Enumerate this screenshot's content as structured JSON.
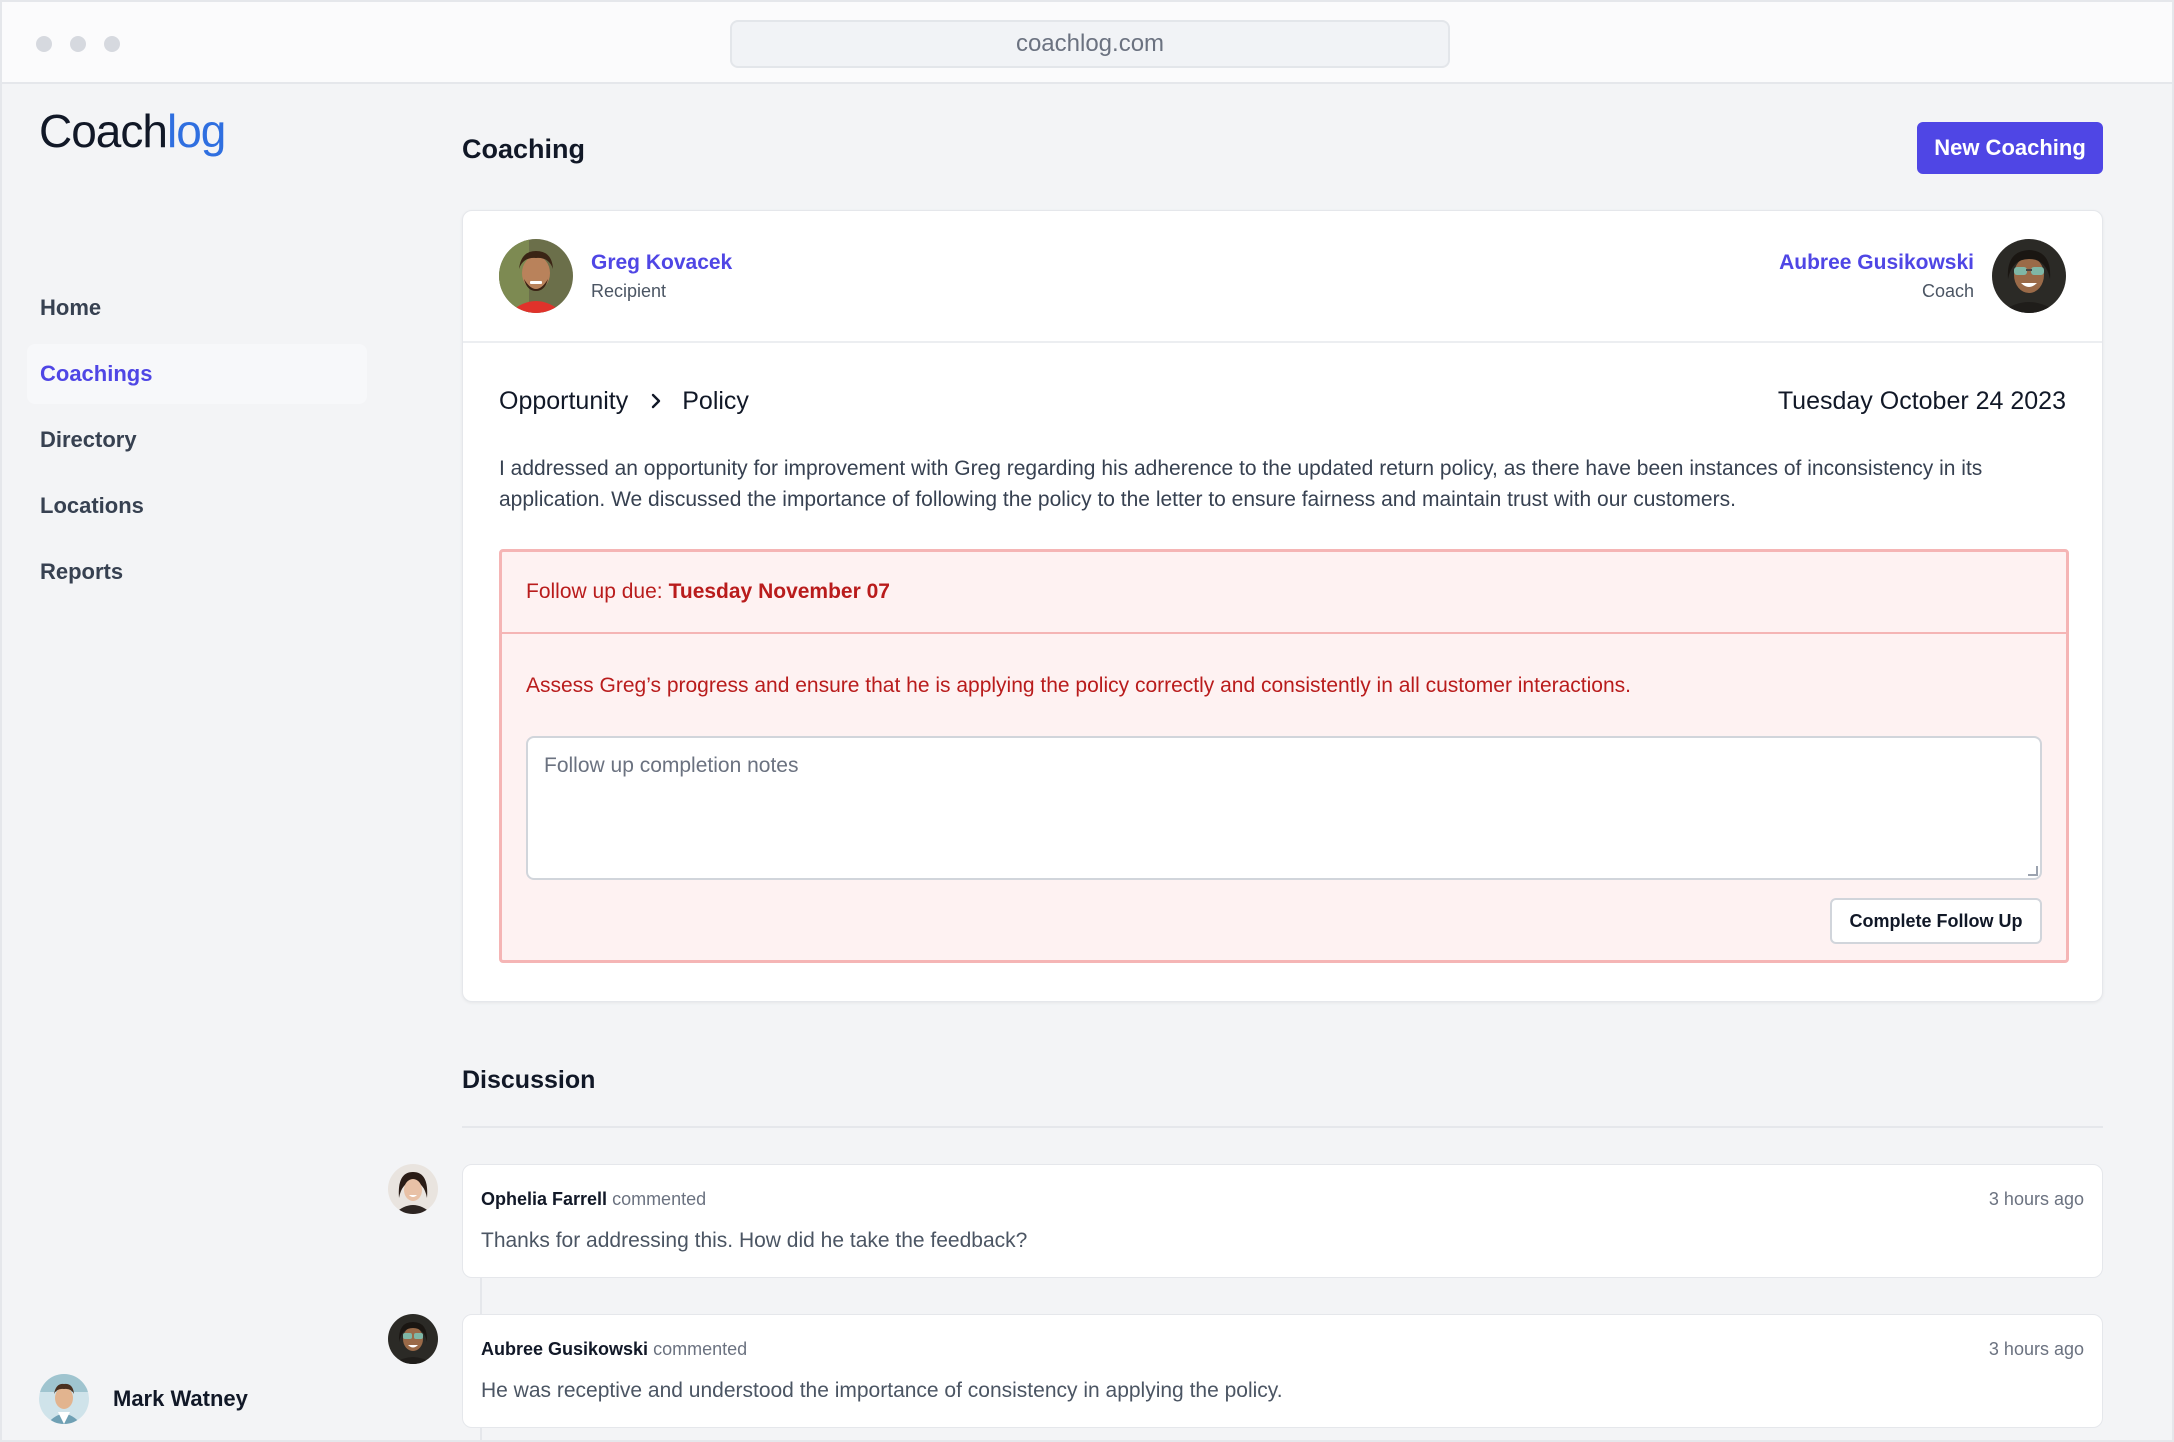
{
  "browser": {
    "url": "coachlog.com"
  },
  "brand": {
    "name_part1": "Coach",
    "name_part2": "log",
    "accent": "#2f6fe0"
  },
  "sidebar": {
    "items": [
      {
        "label": "Home",
        "active": false
      },
      {
        "label": "Coachings",
        "active": true
      },
      {
        "label": "Directory",
        "active": false
      },
      {
        "label": "Locations",
        "active": false
      },
      {
        "label": "Reports",
        "active": false
      }
    ],
    "user": {
      "name": "Mark Watney"
    }
  },
  "header": {
    "title": "Coaching",
    "new_button": "New Coaching",
    "accent": "#4f46e5"
  },
  "coaching": {
    "recipient": {
      "name": "Greg Kovacek",
      "role": "Recipient"
    },
    "coach": {
      "name": "Aubree Gusikowski",
      "role": "Coach"
    },
    "category": "Opportunity",
    "subcategory": "Policy",
    "date": "Tuesday October 24 2023",
    "description": "I addressed an opportunity for improvement with Greg regarding his adherence to the updated return policy, as there have been instances of inconsistency in its application. We discussed the importance of following the policy to the letter to ensure fairness and maintain trust with our customers.",
    "followup": {
      "due_label": "Follow up due:",
      "due_date": "Tuesday November 07",
      "task": "Assess Greg’s progress and ensure that he is applying the policy correctly and consistently in all customer interactions.",
      "notes_placeholder": "Follow up completion notes",
      "notes_value": "",
      "complete_button": "Complete Follow Up",
      "alert_color": "#b91c1c"
    }
  },
  "discussion": {
    "title": "Discussion",
    "comments": [
      {
        "author": "Ophelia Farrell",
        "action": "commented",
        "time": "3 hours ago",
        "text": "Thanks for addressing this. How did he take the feedback?"
      },
      {
        "author": "Aubree Gusikowski",
        "action": "commented",
        "time": "3 hours ago",
        "text": "He was receptive and understood the importance of consistency in applying the policy."
      }
    ]
  }
}
